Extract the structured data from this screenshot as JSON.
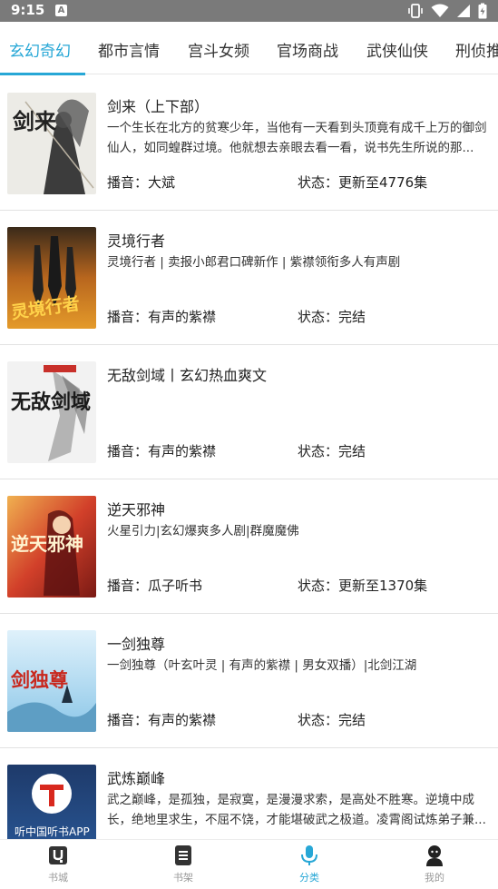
{
  "status_bar": {
    "time": "9:15",
    "notification_letter": "A"
  },
  "tabs": [
    {
      "label": "玄幻奇幻",
      "active": true
    },
    {
      "label": "都市言情",
      "active": false
    },
    {
      "label": "宫斗女频",
      "active": false
    },
    {
      "label": "官场商战",
      "active": false
    },
    {
      "label": "武侠仙侠",
      "active": false
    },
    {
      "label": "刑侦推",
      "active": false
    }
  ],
  "books": [
    {
      "title": "剑来（上下部）",
      "desc": "一个生长在北方的贫寒少年，当他有一天看到头顶竟有成千上万的御剑仙人，如同蝗群过境。他就想去亲眼去看一看，说书先生所说的那...",
      "narrator": "播音：大斌",
      "state": "状态：更新至4776集"
    },
    {
      "title": "灵境行者",
      "desc": "灵境行者 | 卖报小郎君口碑新作 | 紫襟领衔多人有声剧",
      "narrator": "播音：有声的紫襟",
      "state": "状态：完结"
    },
    {
      "title": "无敌剑域丨玄幻热血爽文",
      "desc": "",
      "narrator": "播音：有声的紫襟",
      "state": "状态：完结"
    },
    {
      "title": "逆天邪神",
      "desc": "火星引力|玄幻爆爽多人剧|群魔魔佛",
      "narrator": "播音：瓜子听书",
      "state": "状态：更新至1370集"
    },
    {
      "title": "一剑独尊",
      "desc": "一剑独尊（叶玄叶灵 | 有声的紫襟 | 男女双播）|北剑江湖",
      "narrator": "播音：有声的紫襟",
      "state": "状态：完结"
    },
    {
      "title": "武炼巅峰",
      "desc": "武之巅峰，是孤独，是寂寞，是漫漫求索，是高处不胜寒。逆境中成长，绝地里求生，不屈不饶，才能堪破武之极道。凌霄阁试炼弟子兼...",
      "narrator": "",
      "state": ""
    }
  ],
  "covers": {
    "book0_text": "剑来",
    "book1_text": "灵境行者",
    "book2_text": "无敌剑域",
    "book3_text": "逆天邪神",
    "book4_text": "剑独尊",
    "book5_text": "听中国听书APP"
  },
  "bottom_nav": [
    {
      "label": "书城",
      "icon": "store-icon",
      "active": false
    },
    {
      "label": "书架",
      "icon": "bookshelf-icon",
      "active": false
    },
    {
      "label": "分类",
      "icon": "microphone-icon",
      "active": true
    },
    {
      "label": "我的",
      "icon": "profile-icon",
      "active": false
    }
  ],
  "colors": {
    "accent": "#27a7d6",
    "status_bar": "#7a7a7a",
    "divider": "#e2e2e2"
  }
}
